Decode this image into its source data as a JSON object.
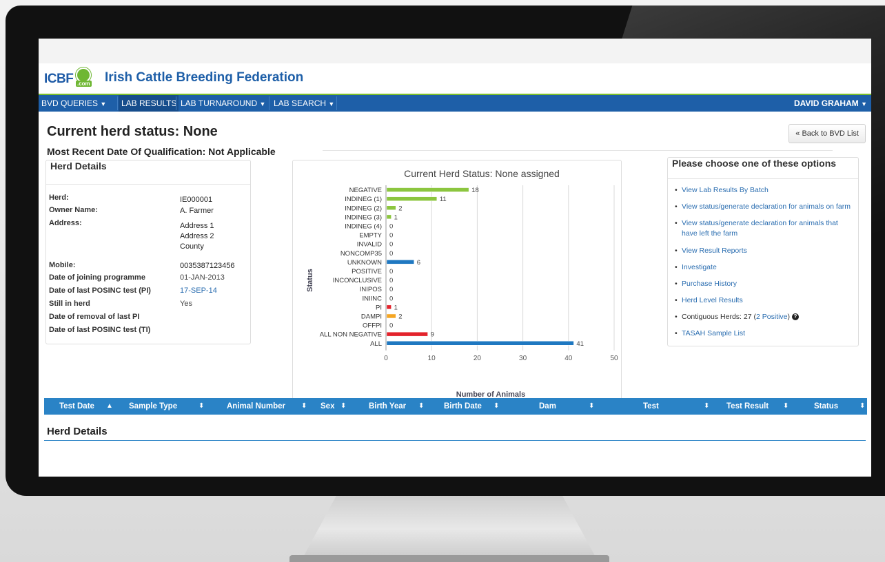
{
  "brand": {
    "logo_text": "ICBF",
    "logo_sub": ".com",
    "name": "Irish Cattle Breeding Federation"
  },
  "nav": {
    "items": [
      {
        "label": "BVD QUERIES",
        "caret": true
      },
      {
        "label": "LAB RESULTS",
        "caret": false,
        "active": true
      },
      {
        "label": "LAB TURNAROUND",
        "caret": true
      },
      {
        "label": "LAB SEARCH",
        "caret": true
      }
    ],
    "user": "DAVID GRAHAM"
  },
  "header": {
    "status": "Current herd status: None",
    "qualification": "Most Recent Date Of Qualification: Not Applicable",
    "back_button": "« Back to BVD List"
  },
  "herd": {
    "title": "Herd Details",
    "rows": [
      {
        "label": "Herd:",
        "value": "IE000001"
      },
      {
        "label": "Owner Name:",
        "value": "A. Farmer"
      },
      {
        "label": "Address:",
        "value_lines": [
          "Address 1",
          "Address 2",
          "County"
        ]
      },
      {
        "label": "Mobile:",
        "value": "0035387123456"
      },
      {
        "label": "Date of joining programme",
        "value": "01-JAN-2013"
      },
      {
        "label": "Date of last POSINC test (PI)",
        "value": "17-SEP-14"
      },
      {
        "label": "Still in herd",
        "value": "Yes"
      },
      {
        "label": "Date of removal of last PI",
        "value": ""
      },
      {
        "label": "Date of last POSINC test (TI)",
        "value": ""
      }
    ]
  },
  "options": {
    "title": "Please choose one of these options",
    "items": [
      "View Lab Results By Batch",
      "View status/generate declaration for animals on farm",
      "View status/generate declaration for animals that have left the farm",
      "View Result Reports",
      "Investigate",
      "Purchase History",
      "Herd Level Results"
    ],
    "contiguous": {
      "prefix": "Contiguous Herds: 27 (",
      "link": "2 Positive",
      "suffix": ")"
    },
    "last_item": "TASAH Sample List"
  },
  "chart_data": {
    "type": "bar",
    "orientation": "horizontal",
    "title": "Current Herd Status: None assigned",
    "xlabel": "Number of Animals",
    "ylabel": "Status",
    "xlim": [
      0,
      50
    ],
    "xticks": [
      0,
      10,
      20,
      30,
      40,
      50
    ],
    "grid": true,
    "categories": [
      "NEGATIVE",
      "INDINEG (1)",
      "INDINEG (2)",
      "INDINEG (3)",
      "INDINEG (4)",
      "EMPTY",
      "INVALID",
      "NONCOMP35",
      "UNKNOWN",
      "POSITIVE",
      "INCONCLUSIVE",
      "INIPOS",
      "INIINC",
      "PI",
      "DAMPI",
      "OFFPI",
      "ALL NON NEGATIVE",
      "ALL"
    ],
    "values": [
      18,
      11,
      2,
      1,
      0,
      0,
      0,
      0,
      6,
      0,
      0,
      0,
      0,
      1,
      2,
      0,
      9,
      41
    ],
    "bar_colors": [
      "#8cc63f",
      "#8cc63f",
      "#8cc63f",
      "#8cc63f",
      "#8cc63f",
      "#8cc63f",
      "#8cc63f",
      "#8cc63f",
      "#1f78c1",
      "#1f78c1",
      "#1f78c1",
      "#1f78c1",
      "#1f78c1",
      "#e3232c",
      "#f5a623",
      "#f5a623",
      "#e3232c",
      "#1f78c1"
    ]
  },
  "table": {
    "columns": [
      {
        "label": "Test Date",
        "sort": "▲"
      },
      {
        "label": "Sample Type",
        "sort": "⬍"
      },
      {
        "label": "Animal Number",
        "sort": "⬍"
      },
      {
        "label": "Sex",
        "sort": "⬍"
      },
      {
        "label": "Birth Year",
        "sort": "⬍"
      },
      {
        "label": "Birth Date",
        "sort": "⬍"
      },
      {
        "label": "Dam",
        "sort": "⬍"
      },
      {
        "label": "Test",
        "sort": "⬍"
      },
      {
        "label": "Test Result",
        "sort": "⬍"
      },
      {
        "label": "Status",
        "sort": "⬍"
      }
    ]
  },
  "footer": {
    "section_title": "Herd Details"
  }
}
